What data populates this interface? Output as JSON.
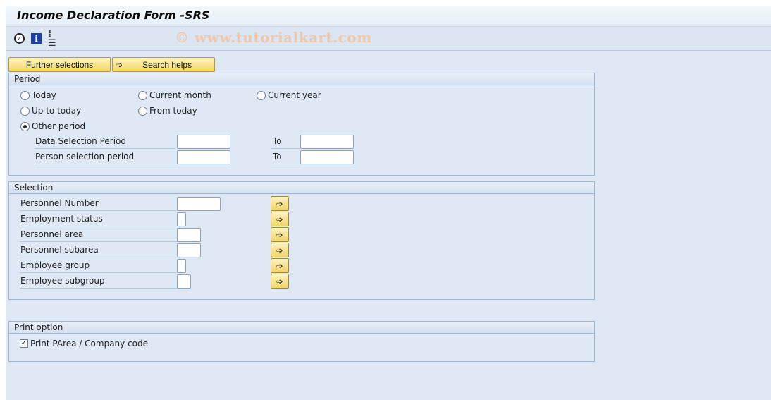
{
  "app": {
    "title": "Income Declaration Form -SRS",
    "watermark": "© www.tutorialkart.com"
  },
  "toolbar": {
    "icons": [
      "execute-icon",
      "information-icon",
      "selection-options-icon"
    ],
    "execute_glyph": "✓",
    "info_glyph": "i",
    "selopt_glyph": "⁞☰"
  },
  "buttons": {
    "further_selections": "Further selections",
    "search_helps": "Search helps",
    "arrow_glyph": "➩"
  },
  "period": {
    "heading": "Period",
    "radios": [
      {
        "label": "Today",
        "selected": false
      },
      {
        "label": "Current month",
        "selected": false
      },
      {
        "label": "Current year",
        "selected": false
      },
      {
        "label": "Up to today",
        "selected": false
      },
      {
        "label": "From today",
        "selected": false
      },
      {
        "label": "Other period",
        "selected": true
      }
    ],
    "ranges": [
      {
        "label": "Data Selection Period",
        "to_label": "To",
        "from_value": "",
        "to_value": ""
      },
      {
        "label": "Person selection period",
        "to_label": "To",
        "from_value": "",
        "to_value": ""
      }
    ]
  },
  "selection": {
    "heading": "Selection",
    "fields": [
      {
        "label": "Personnel Number",
        "value": ""
      },
      {
        "label": "Employment status",
        "value": ""
      },
      {
        "label": "Personnel area",
        "value": ""
      },
      {
        "label": "Personnel subarea",
        "value": ""
      },
      {
        "label": "Employee group",
        "value": ""
      },
      {
        "label": "Employee subgroup",
        "value": ""
      }
    ]
  },
  "print_option": {
    "heading": "Print option",
    "checkbox_label": "Print PArea / Company code",
    "checked": true,
    "check_glyph": "✓"
  }
}
